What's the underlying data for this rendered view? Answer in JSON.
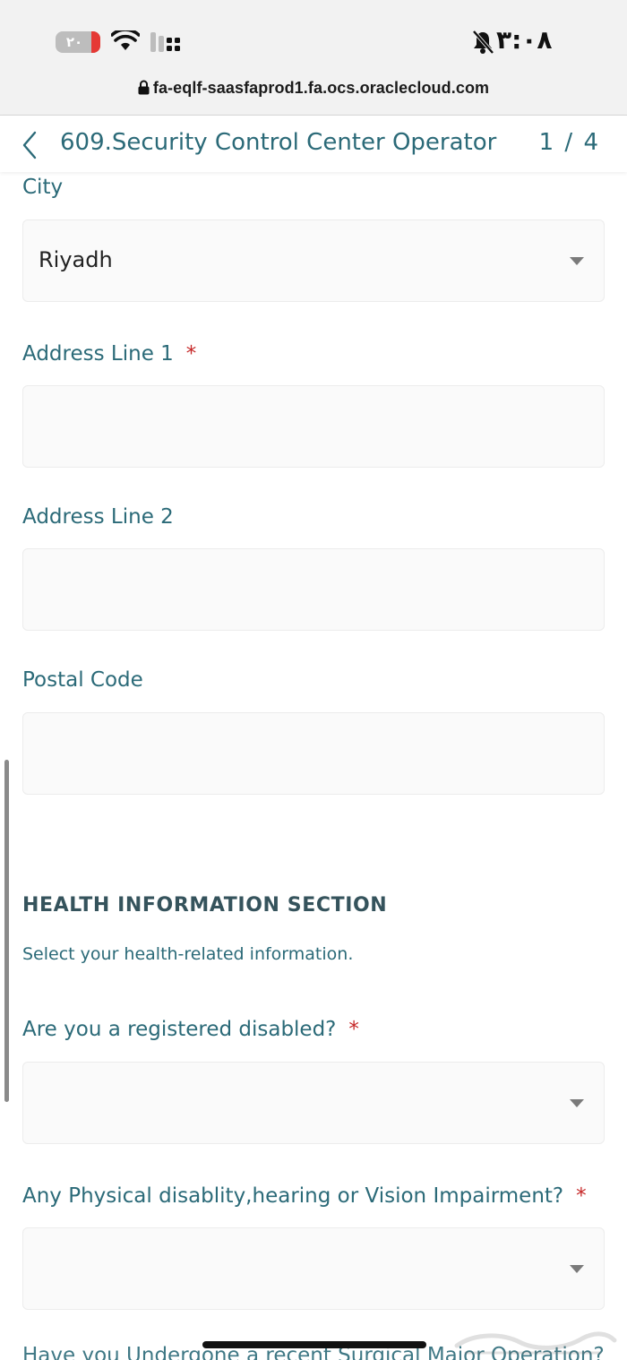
{
  "status_bar": {
    "battery": "٢٠",
    "time": "٣:٠٨",
    "url": "fa-eqlf-saasfaprod1.fa.ocs.oraclecloud.com"
  },
  "header": {
    "title": "609.Security Control Center Operator",
    "pager": "1 / 4"
  },
  "form": {
    "city": {
      "label": "City",
      "value": "Riyadh"
    },
    "address1": {
      "label": "Address Line 1",
      "required": "*",
      "value": ""
    },
    "address2": {
      "label": "Address Line 2",
      "value": ""
    },
    "postal": {
      "label": "Postal Code",
      "value": ""
    }
  },
  "health": {
    "title": "HEALTH INFORMATION SECTION",
    "description": "Select your health-related information.",
    "q1": {
      "label": "Are you a registered disabled?",
      "required": "*",
      "value": ""
    },
    "q2": {
      "label": "Any Physical disablity,hearing or Vision Impairment?",
      "required": "*",
      "value": ""
    },
    "q3": {
      "label": "Have you Undergone a recent Surgical Major Operation?"
    }
  },
  "colors": {
    "accent": "#2b6a78",
    "required": "#c62828",
    "field_bg": "#fafafa"
  },
  "icons": [
    "battery-icon",
    "wifi-icon",
    "signal-icon",
    "bell-off-icon",
    "lock-icon",
    "back-chevron-icon",
    "dropdown-caret-icon"
  ]
}
